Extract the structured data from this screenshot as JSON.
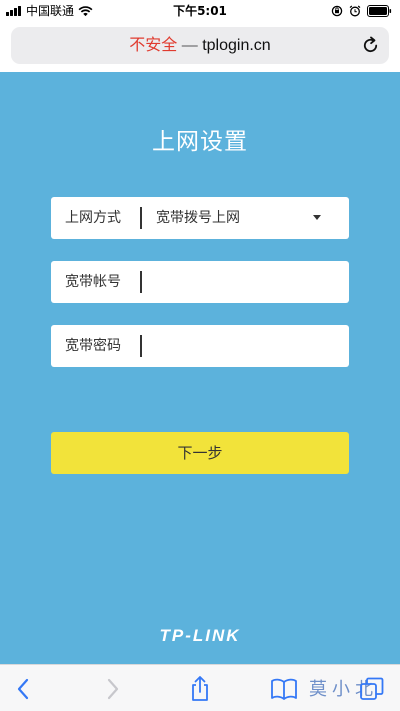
{
  "status_bar": {
    "carrier": "中国联通",
    "time": "下午5:01"
  },
  "address_bar": {
    "security_label": "不安全",
    "separator": "—",
    "host": "tplogin.cn"
  },
  "page": {
    "title": "上网设置",
    "connection_type": {
      "label": "上网方式",
      "value": "宽带拨号上网"
    },
    "account": {
      "label": "宽带帐号",
      "value": ""
    },
    "password": {
      "label": "宽带密码",
      "value": ""
    },
    "next_button": "下一步",
    "logo": "TP-LINK"
  },
  "toolbar": {
    "watermark": "莫小北"
  },
  "colors": {
    "page_background": "#5cb2dc",
    "button": "#f2e33a",
    "not_secure": "#e03b2f"
  }
}
